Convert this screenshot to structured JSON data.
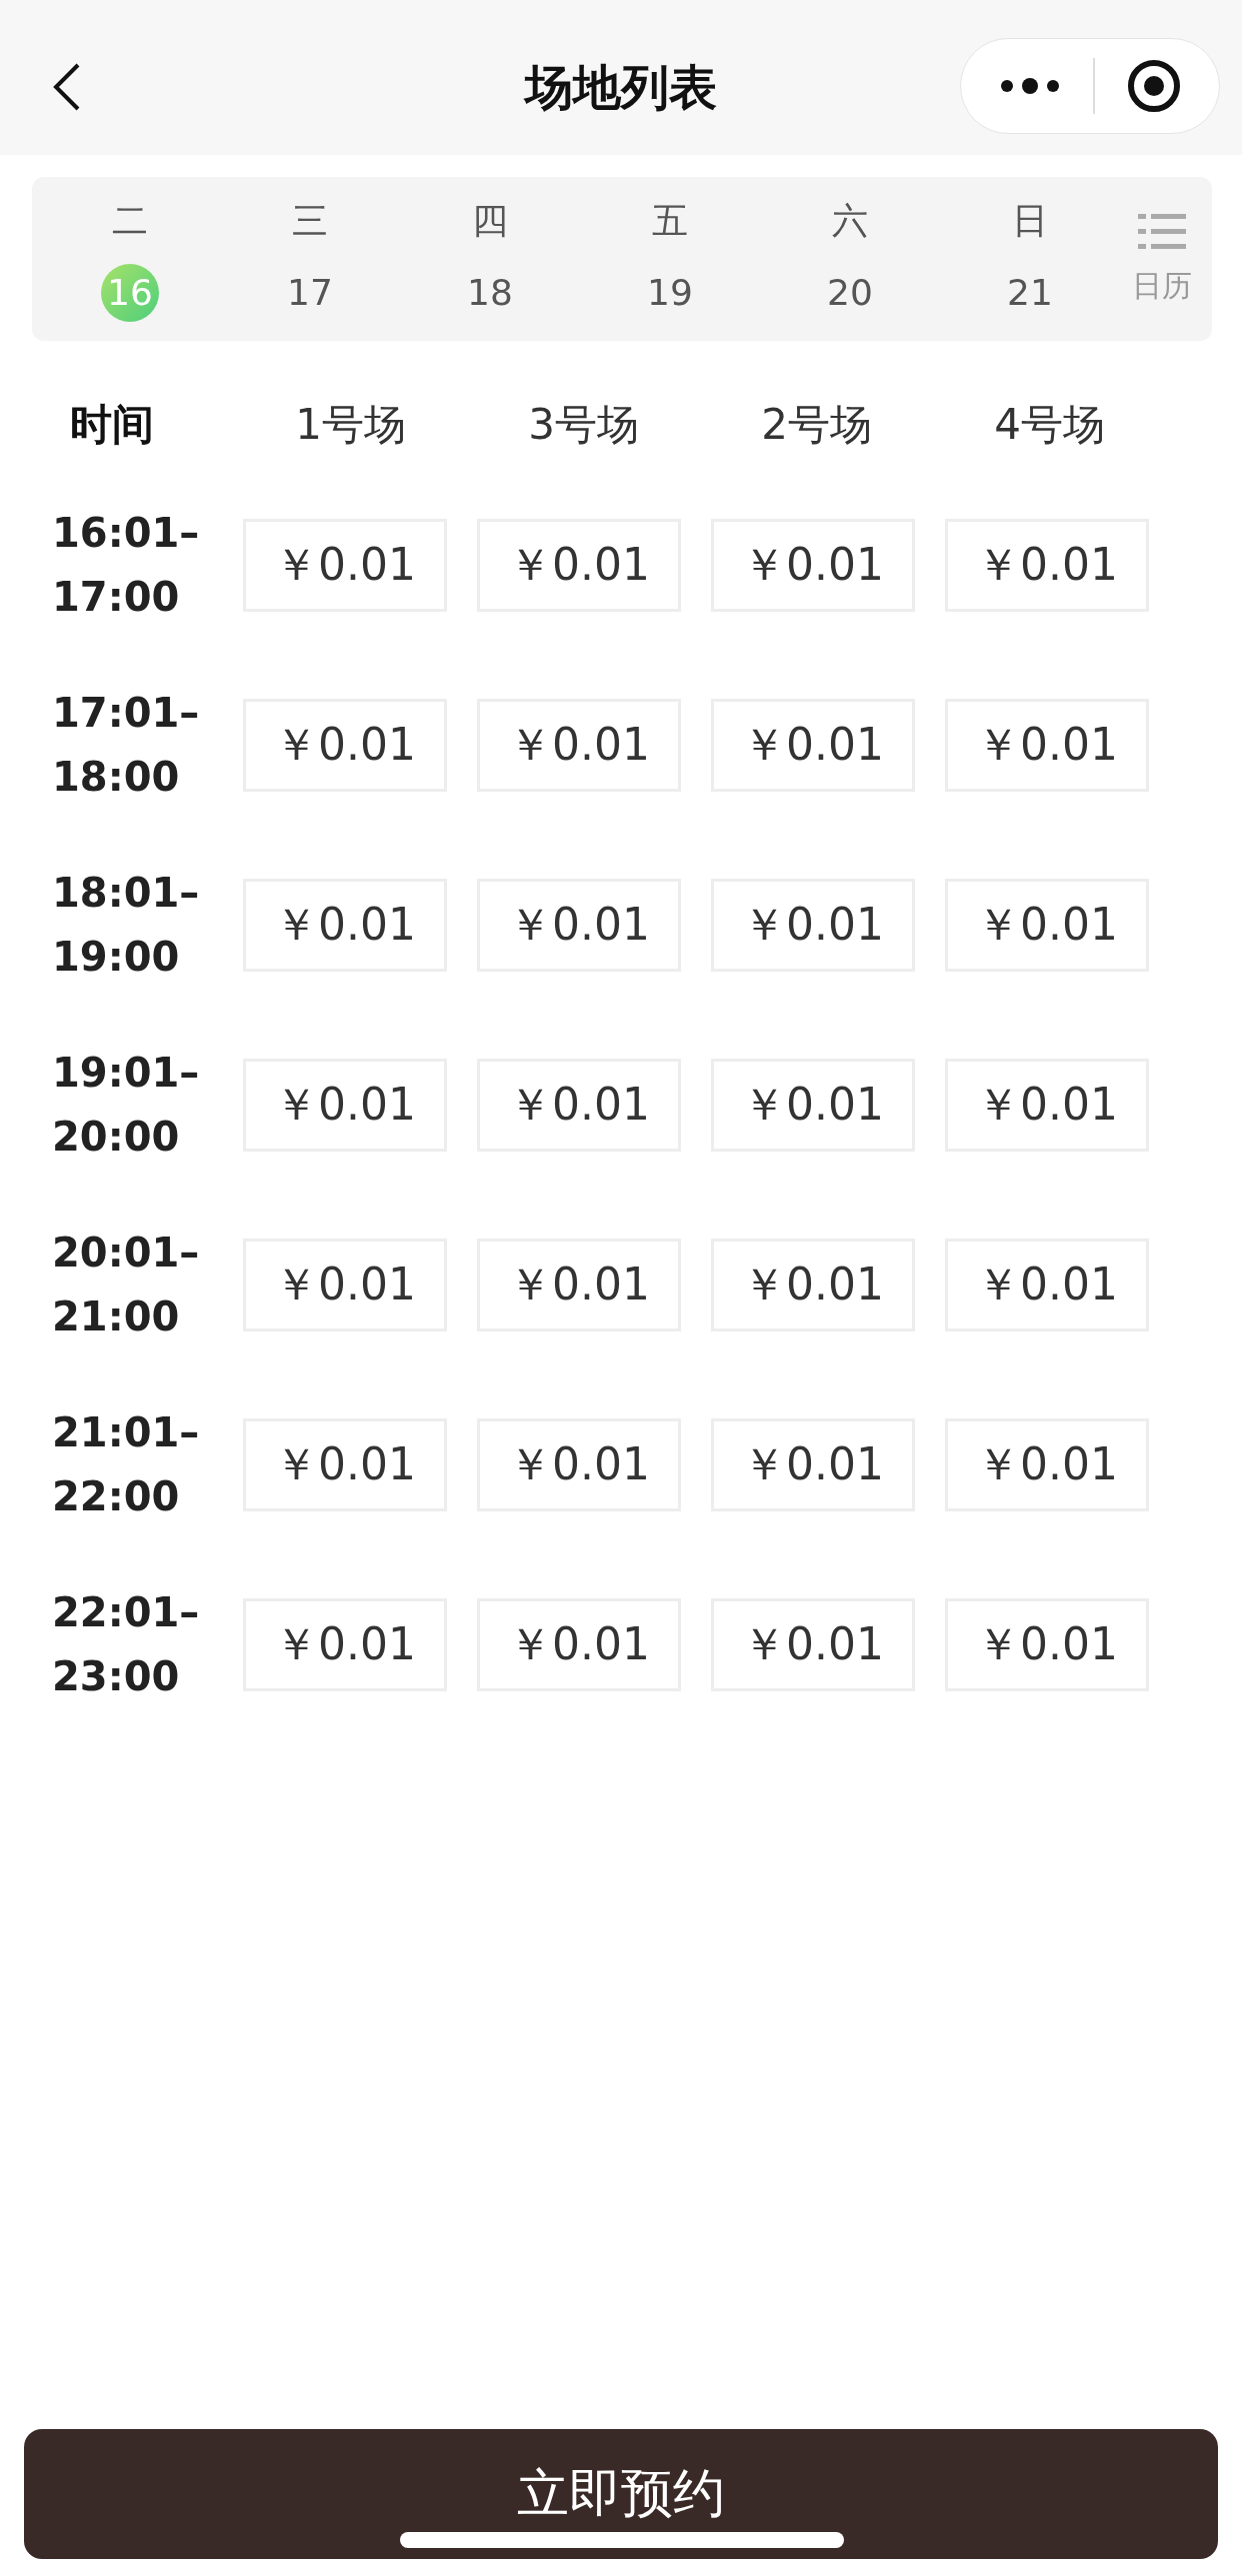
{
  "nav": {
    "title": "场地列表"
  },
  "dates": [
    {
      "weekday": "二",
      "day": "16",
      "selected": true
    },
    {
      "weekday": "三",
      "day": "17",
      "selected": false
    },
    {
      "weekday": "四",
      "day": "18",
      "selected": false
    },
    {
      "weekday": "五",
      "day": "19",
      "selected": false
    },
    {
      "weekday": "六",
      "day": "20",
      "selected": false
    },
    {
      "weekday": "日",
      "day": "21",
      "selected": false
    }
  ],
  "calendar_label": "日历",
  "table": {
    "columns": [
      "时间",
      "1号场",
      "3号场",
      "2号场",
      "4号场"
    ],
    "rows": [
      {
        "time": "16:01–\n17:00",
        "prices": [
          "￥0.01",
          "￥0.01",
          "￥0.01",
          "￥0.01"
        ]
      },
      {
        "time": "17:01–\n18:00",
        "prices": [
          "￥0.01",
          "￥0.01",
          "￥0.01",
          "￥0.01"
        ]
      },
      {
        "time": "18:01–\n19:00",
        "prices": [
          "￥0.01",
          "￥0.01",
          "￥0.01",
          "￥0.01"
        ]
      },
      {
        "time": "19:01–\n20:00",
        "prices": [
          "￥0.01",
          "￥0.01",
          "￥0.01",
          "￥0.01"
        ]
      },
      {
        "time": "20:01–\n21:00",
        "prices": [
          "￥0.01",
          "￥0.01",
          "￥0.01",
          "￥0.01"
        ]
      },
      {
        "time": "21:01–\n22:00",
        "prices": [
          "￥0.01",
          "￥0.01",
          "￥0.01",
          "￥0.01"
        ]
      },
      {
        "time": "22:01–\n23:00",
        "prices": [
          "￥0.01",
          "￥0.01",
          "￥0.01",
          "￥0.01"
        ]
      }
    ]
  },
  "book_button": "立即预约"
}
